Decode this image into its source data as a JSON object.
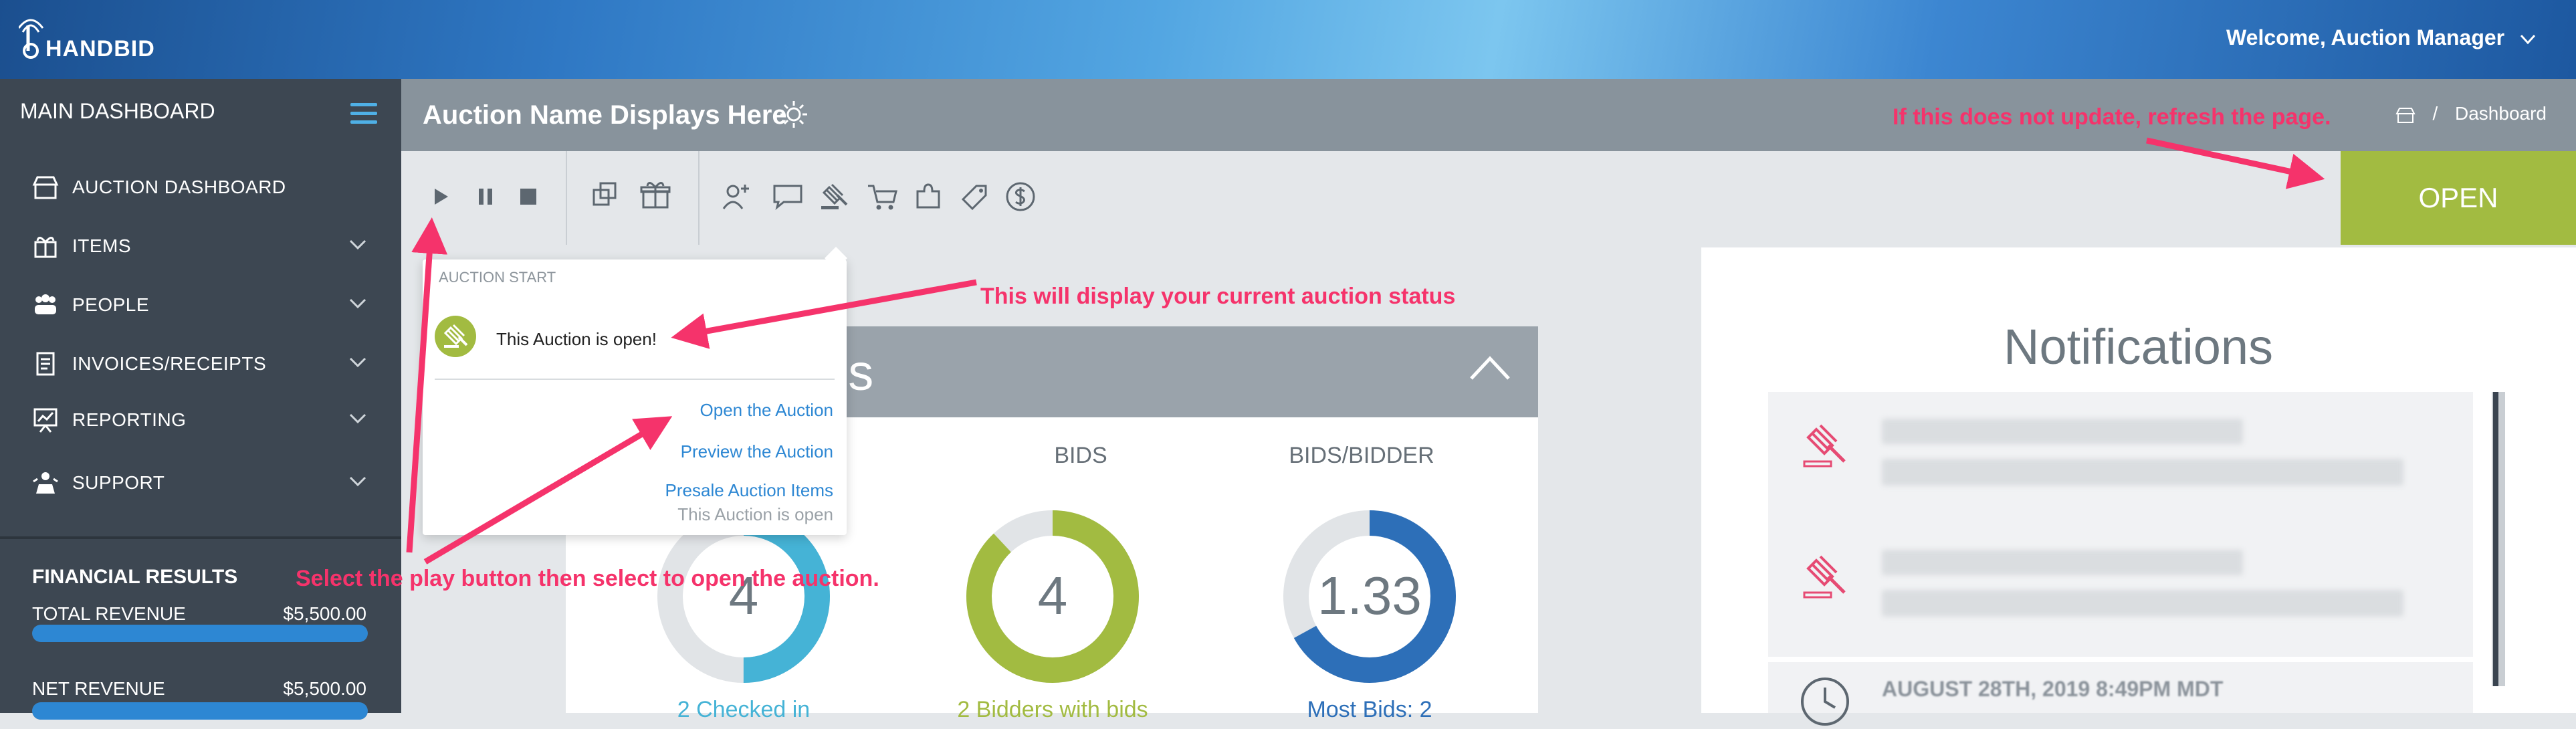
{
  "brand": {
    "logo_text": "HANDBID"
  },
  "header": {
    "welcome": "Welcome, Auction Manager"
  },
  "sidebar": {
    "title": "MAIN DASHBOARD",
    "items": [
      {
        "label": "AUCTION DASHBOARD",
        "icon": "store-icon"
      },
      {
        "label": "ITEMS",
        "icon": "gift-icon"
      },
      {
        "label": "PEOPLE",
        "icon": "people-icon"
      },
      {
        "label": "INVOICES/RECEIPTS",
        "icon": "receipt-icon"
      },
      {
        "label": "REPORTING",
        "icon": "chart-board-icon"
      },
      {
        "label": "SUPPORT",
        "icon": "support-icon"
      }
    ],
    "financial": {
      "title": "FINANCIAL RESULTS",
      "rows": [
        {
          "label": "TOTAL REVENUE",
          "value": "$5,500.00",
          "fill": 1.0
        },
        {
          "label": "NET REVENUE",
          "value": "$5,500.00",
          "fill": 1.0
        }
      ]
    }
  },
  "page": {
    "auction_name": "Auction Name Displays Here",
    "breadcrumb": {
      "separator": "/",
      "current": "Dashboard"
    }
  },
  "status_button": {
    "label": "OPEN",
    "color": "#a2bb41"
  },
  "popup": {
    "heading": "AUCTION START",
    "status": "This Auction is open!",
    "links": [
      "Open the Auction",
      "Preview the Auction",
      "Presale Auction Items"
    ],
    "note": "This Auction is open"
  },
  "stats": {
    "panel_title_visible": "ds",
    "cards": [
      {
        "label": "",
        "value": "4",
        "footer": "2 Checked in",
        "color": "#45b3d6",
        "fraction": 0.5
      },
      {
        "label": "BIDS",
        "value": "4",
        "footer": "2 Bidders with bids",
        "color": "#a2bb41",
        "fraction": 0.88
      },
      {
        "label": "BIDS/BIDDER",
        "value": "1.33",
        "footer": "Most Bids: 2",
        "color": "#2d6fb8",
        "fraction": 0.67
      }
    ]
  },
  "notifications": {
    "title": "Notifications",
    "partial_timestamp": "AUGUST 28TH, 2019 8:49PM MDT"
  },
  "annotations": {
    "refresh": "If this does not update, refresh the page.",
    "status": "This will display your current auction status",
    "play": "Select the play button then select to open the auction."
  }
}
